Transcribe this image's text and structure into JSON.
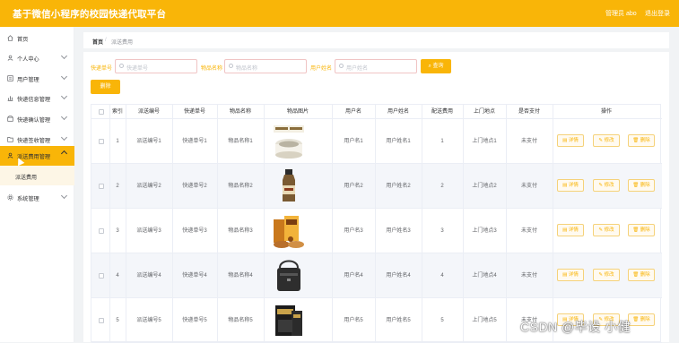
{
  "header": {
    "title": "基于微信小程序的校园快递代取平台",
    "admin_label": "管理员 abo",
    "logout_label": "退出登录"
  },
  "sidebar": {
    "items": [
      {
        "label": "首页",
        "icon": "home-icon"
      },
      {
        "label": "个人中心",
        "icon": "user-icon"
      },
      {
        "label": "用户管理",
        "icon": "list-icon"
      },
      {
        "label": "快递信息管理",
        "icon": "chart-icon"
      },
      {
        "label": "快递确认管理",
        "icon": "box-icon"
      },
      {
        "label": "快递签收管理",
        "icon": "folder-icon"
      },
      {
        "label": "派送费用管理",
        "icon": "user-icon"
      },
      {
        "label": "系统管理",
        "icon": "gear-icon"
      }
    ],
    "submenu_item": "派送费用"
  },
  "breadcrumb": {
    "home": "首页",
    "separator": "/",
    "current": "派送费用"
  },
  "filters": {
    "tracking_label": "快递单号",
    "tracking_placeholder": "快递单号",
    "item_label": "物品名称",
    "item_placeholder": "物品名称",
    "name_label": "用户姓名",
    "name_placeholder": "用户姓名",
    "search_button": "查询",
    "delete_button": "删除"
  },
  "table": {
    "columns": [
      "索引",
      "派送编号",
      "快递单号",
      "物品名称",
      "物品图片",
      "用户名",
      "用户姓名",
      "配送费用",
      "上门地点",
      "是否支付",
      "操作"
    ],
    "rows": [
      {
        "index": "1",
        "delivery_no": "派送编号1",
        "tracking_no": "快递单号1",
        "item_name": "物品名称1",
        "username": "用户名1",
        "user_realname": "用户姓名1",
        "fee": "1",
        "location": "上门地点1",
        "paid": "未支付"
      },
      {
        "index": "2",
        "delivery_no": "派送编号2",
        "tracking_no": "快递单号2",
        "item_name": "物品名称2",
        "username": "用户名2",
        "user_realname": "用户姓名2",
        "fee": "2",
        "location": "上门地点2",
        "paid": "未支付"
      },
      {
        "index": "3",
        "delivery_no": "派送编号3",
        "tracking_no": "快递单号3",
        "item_name": "物品名称3",
        "username": "用户名3",
        "user_realname": "用户姓名3",
        "fee": "3",
        "location": "上门地点3",
        "paid": "未支付"
      },
      {
        "index": "4",
        "delivery_no": "派送编号4",
        "tracking_no": "快递单号4",
        "item_name": "物品名称4",
        "username": "用户名4",
        "user_realname": "用户姓名4",
        "fee": "4",
        "location": "上门地点4",
        "paid": "未支付"
      },
      {
        "index": "5",
        "delivery_no": "派送编号5",
        "tracking_no": "快递单号5",
        "item_name": "物品名称5",
        "username": "用户名5",
        "user_realname": "用户姓名5",
        "fee": "5",
        "location": "上门地点5",
        "paid": "未支付"
      }
    ],
    "actions": {
      "detail": "详情",
      "edit": "修改",
      "delete": "删除"
    }
  },
  "watermark": "CSDN @毕设 小健",
  "colors": {
    "accent": "#f9b508",
    "header_text": "#ffffff"
  }
}
